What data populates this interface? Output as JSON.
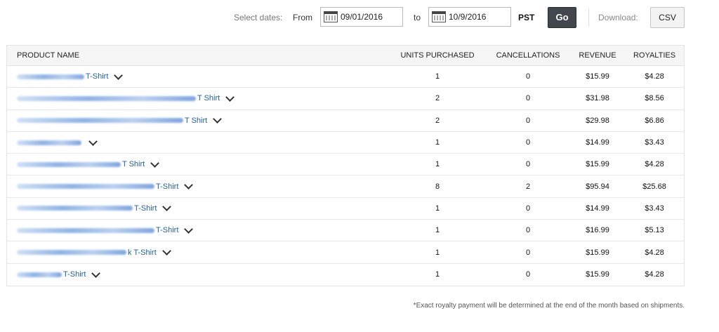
{
  "toolbar": {
    "select_dates_label": "Select dates:",
    "from_label": "From",
    "from_date": "09/01/2016",
    "to_label": "to",
    "to_date": "10/9/2016",
    "timezone": "PST",
    "go_button": "Go",
    "download_label": "Download:",
    "csv_button": "CSV",
    "calendar_icon": "calendar-icon"
  },
  "table": {
    "columns": [
      "PRODUCT NAME",
      "UNITS PURCHASED",
      "CANCELLATIONS",
      "REVENUE",
      "ROYALTIES"
    ],
    "rows": [
      {
        "name": "T-Shirt",
        "units": "1",
        "cancellations": "0",
        "revenue": "$15.99",
        "royalties": "$4.28"
      },
      {
        "name": "T Shirt",
        "units": "2",
        "cancellations": "0",
        "revenue": "$31.98",
        "royalties": "$8.56"
      },
      {
        "name": "T Shirt",
        "units": "2",
        "cancellations": "0",
        "revenue": "$29.98",
        "royalties": "$6.86"
      },
      {
        "name": "",
        "units": "1",
        "cancellations": "0",
        "revenue": "$14.99",
        "royalties": "$3.43"
      },
      {
        "name": "T Shirt",
        "units": "1",
        "cancellations": "0",
        "revenue": "$15.99",
        "royalties": "$4.28"
      },
      {
        "name": "T-Shirt",
        "units": "8",
        "cancellations": "2",
        "revenue": "$95.94",
        "royalties": "$25.68"
      },
      {
        "name": "T-Shirt",
        "units": "1",
        "cancellations": "0",
        "revenue": "$14.99",
        "royalties": "$3.43"
      },
      {
        "name": "T-Shirt",
        "units": "1",
        "cancellations": "0",
        "revenue": "$16.99",
        "royalties": "$5.13"
      },
      {
        "name": "k T-Shirt",
        "units": "1",
        "cancellations": "0",
        "revenue": "$15.99",
        "royalties": "$4.28"
      },
      {
        "name": "T-Shirt",
        "units": "1",
        "cancellations": "0",
        "revenue": "$15.99",
        "royalties": "$4.28"
      }
    ]
  },
  "footnote": "*Exact royalty payment will be determined at the end of the month based on shipments.",
  "colors": {
    "link": "#1f5fa8",
    "go_button_bg": "#41474d",
    "header_bg": "#f5f5f5"
  }
}
